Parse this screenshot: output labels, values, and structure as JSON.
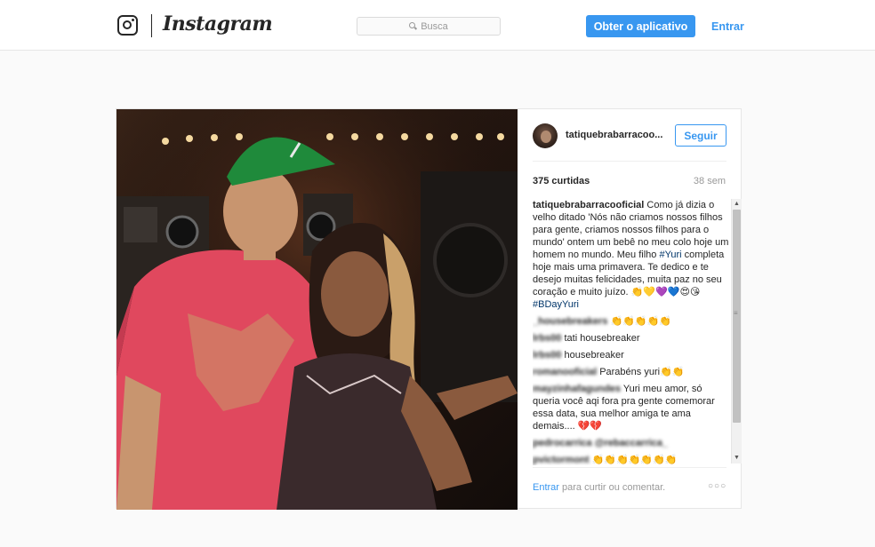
{
  "header": {
    "brand": "Instagram",
    "search_placeholder": "Busca",
    "get_app_label": "Obter o aplicativo",
    "login_label": "Entrar"
  },
  "post": {
    "owner": "tatiquebrabarracoo...",
    "follow_label": "Seguir",
    "likes": "375 curtidas",
    "time": "38 sem",
    "caption": {
      "user": "tatiquebrabarracooficial",
      "text1": "Como já dizia o velho ditado 'Nós não criamos nossos filhos para gente, criamos nossos filhos para o mundo' ontem um bebê no meu colo hoje um homem no mundo. Meu filho",
      "hashtag1": "#Yuri",
      "text2": "completa hoje mais uma primavera. Te dedico e te desejo muitas felicidades, muita paz no seu coração e muito juízo. 👏💛💜💙😍😘",
      "hashtag2": "#BDayYuri"
    },
    "comments": [
      {
        "user": "_housebreakers",
        "text": "👏👏👏👏👏"
      },
      {
        "user": "lrbs00",
        "text": "tati housebreaker"
      },
      {
        "user": "lrbs00",
        "text": "housebreaker"
      },
      {
        "user": "romanooficial",
        "text": "Parabéns yuri👏👏"
      },
      {
        "user": "mayzinhafagundes",
        "text": "Yuri meu amor, só queria você aqi fora pra gente comemorar essa data, sua melhor amiga te ama demais.... 💔💔"
      },
      {
        "user": "pedrocarrica",
        "text": "@rebaccarrica_"
      },
      {
        "user": "pvictormont",
        "text": "👏👏👏👏👏👏👏"
      }
    ],
    "login_prompt": {
      "link": "Entrar",
      "text": "para curtir ou comentar."
    },
    "more_label": "○○○"
  },
  "colors": {
    "accent": "#3897f0",
    "shirt": "#e0485e",
    "cap": "#1f8a3b"
  }
}
